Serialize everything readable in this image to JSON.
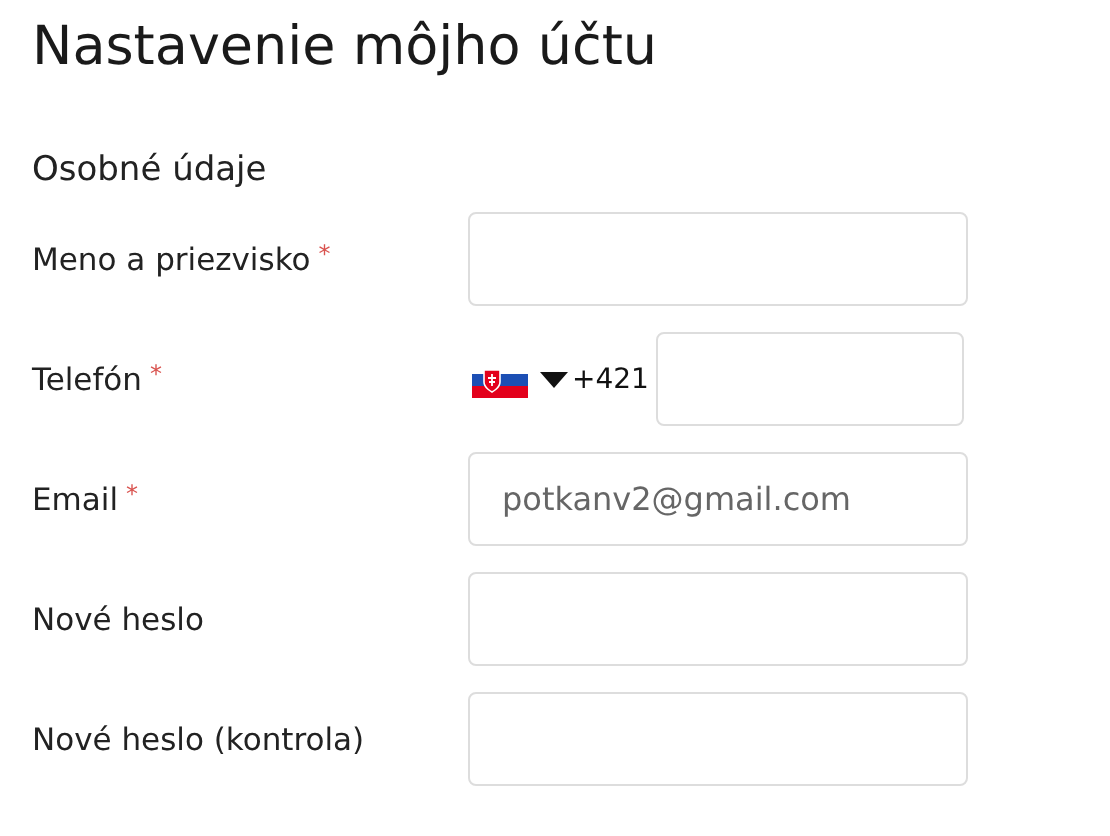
{
  "title": "Nastavenie môjho účtu",
  "section": "Osobné údaje",
  "fields": [
    {
      "kind": "text",
      "label": "Meno a priezvisko",
      "required_mark": "*"
    },
    {
      "kind": "phone",
      "label": "Telefón",
      "required_mark": "*",
      "dial_code": "+421"
    },
    {
      "kind": "text",
      "label": "Email",
      "required_mark": "*",
      "value": "potkanv2@gmail.com"
    },
    {
      "kind": "text",
      "label": "Nové heslo"
    },
    {
      "kind": "text",
      "label": "Nové heslo (kontrola)"
    }
  ]
}
